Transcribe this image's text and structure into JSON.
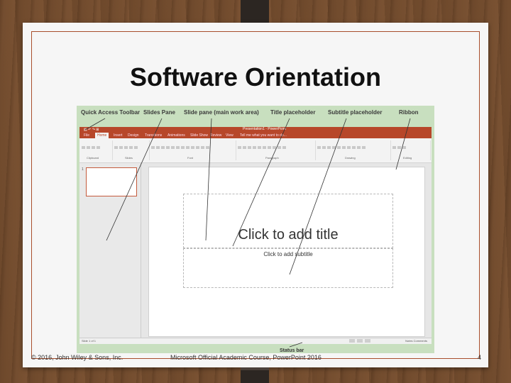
{
  "slide": {
    "title": "Software Orientation",
    "footer_left": "© 2016, John Wiley & Sons, Inc.",
    "footer_center": "Microsoft Official Academic Course, PowerPoint 2016",
    "page_number": "4"
  },
  "screenshot": {
    "callouts": {
      "quick_access_toolbar": "Quick Access Toolbar",
      "slides_pane": "Slides Pane",
      "slide_pane": "Slide pane (main work area)",
      "title_placeholder": "Title placeholder",
      "subtitle_placeholder": "Subtitle placeholder",
      "ribbon": "Ribbon",
      "status_bar": "Status bar"
    },
    "app": {
      "window_title": "Presentation1 - PowerPoint",
      "tabs": [
        "File",
        "Home",
        "Insert",
        "Design",
        "Transitions",
        "Animations",
        "Slide Show",
        "Review",
        "View"
      ],
      "tell_me": "Tell me what you want to do...",
      "ribbon_groups": [
        "Clipboard",
        "Slides",
        "Font",
        "Paragraph",
        "Drawing",
        "Editing"
      ],
      "slide_number": "1",
      "title_placeholder_text": "Click to add title",
      "subtitle_placeholder_text": "Click to add subtitle",
      "status_text": "Slide 1 of 1",
      "status_right": "Notes  Comments"
    }
  },
  "colors": {
    "ppt_red": "#b7472a",
    "callout_bg": "#c8dfbf",
    "slide_border": "#a84e2c"
  }
}
